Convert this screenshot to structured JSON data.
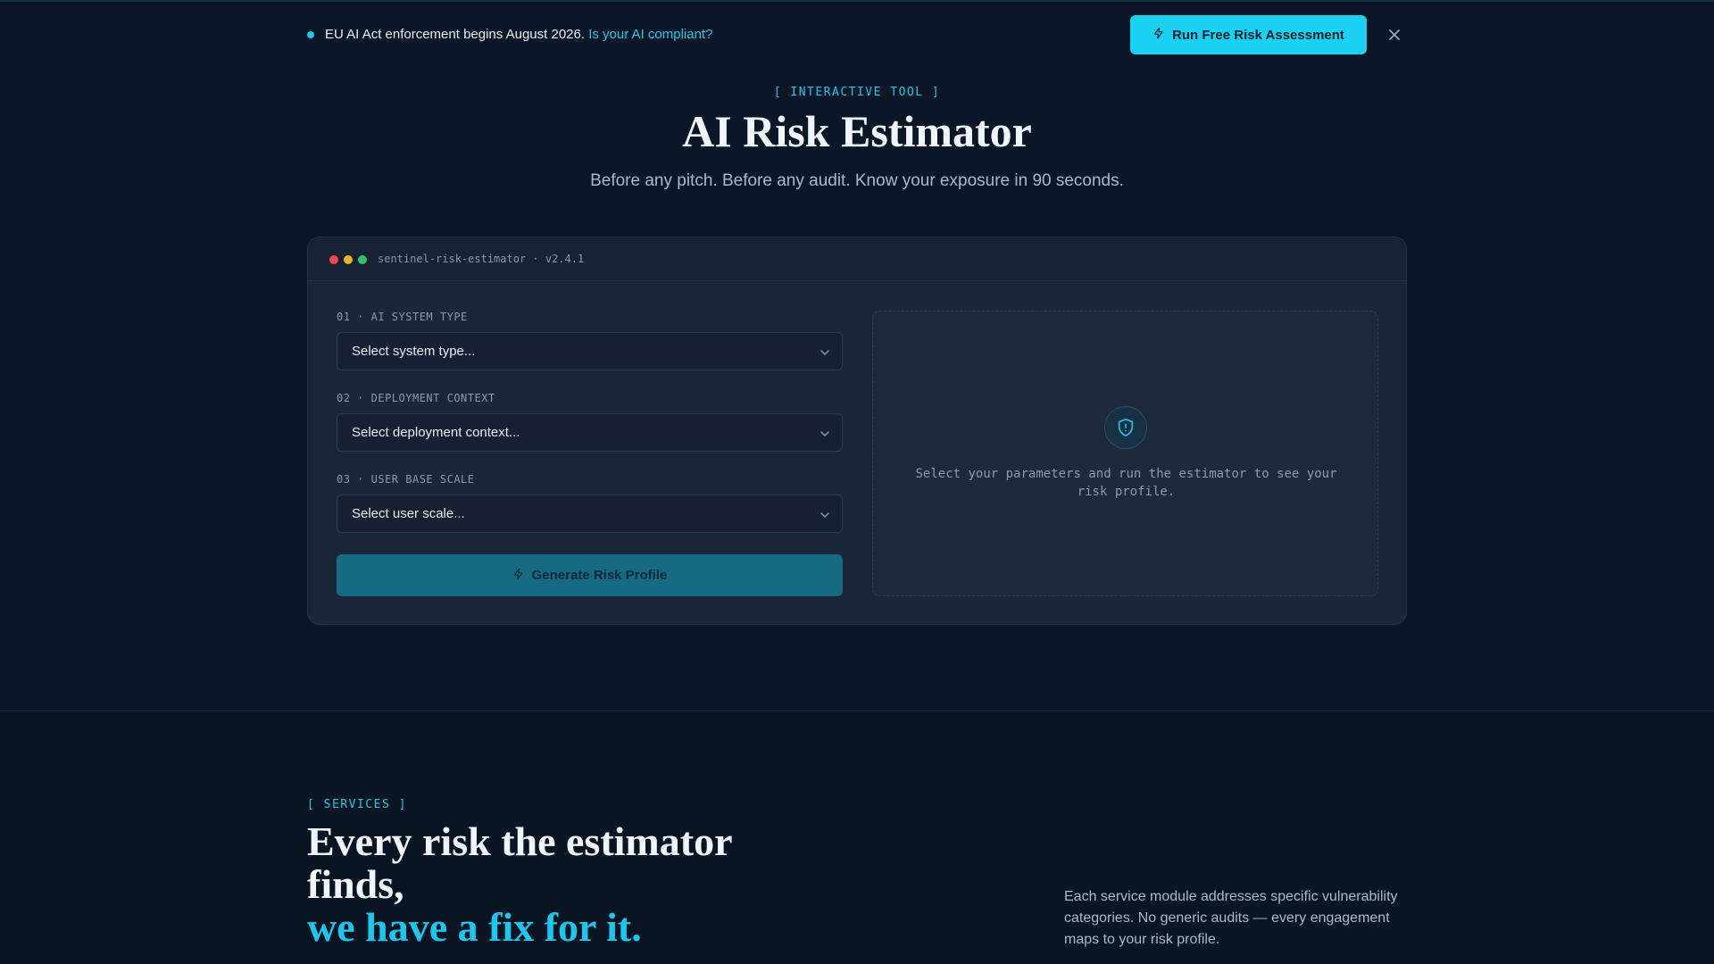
{
  "banner": {
    "text": "EU AI Act enforcement begins August 2026.",
    "link": "Is your AI compliant?",
    "cta_label": "Run Free Risk Assessment"
  },
  "hero": {
    "tag": "[ INTERACTIVE TOOL ]",
    "title": "AI Risk Estimator",
    "subtitle": "Before any pitch. Before any audit. Know your exposure in 90 seconds."
  },
  "estimator": {
    "window_title": "sentinel-risk-estimator · v2.4.1",
    "fields": [
      {
        "label": "01 · AI SYSTEM TYPE",
        "value": "Select system type..."
      },
      {
        "label": "02 · DEPLOYMENT CONTEXT",
        "value": "Select deployment context..."
      },
      {
        "label": "03 · USER BASE SCALE",
        "value": "Select user scale..."
      }
    ],
    "generate_label": "Generate Risk Profile",
    "empty_message": "Select your parameters and run the estimator to see your risk profile."
  },
  "services": {
    "tag": "[ SERVICES ]",
    "heading_line1": "Every risk the estimator finds,",
    "heading_line2": "we have a fix for it.",
    "description": "Each service module addresses specific vulnerability categories. No generic audits — every engagement maps to your risk profile."
  },
  "colors": {
    "accent": "#1ad1f2",
    "background": "#0b1627",
    "card": "#1b2738",
    "generate_button": "#176a84"
  },
  "icons": [
    "bolt-icon",
    "close-icon",
    "chevron-down-icon",
    "shield-icon"
  ]
}
